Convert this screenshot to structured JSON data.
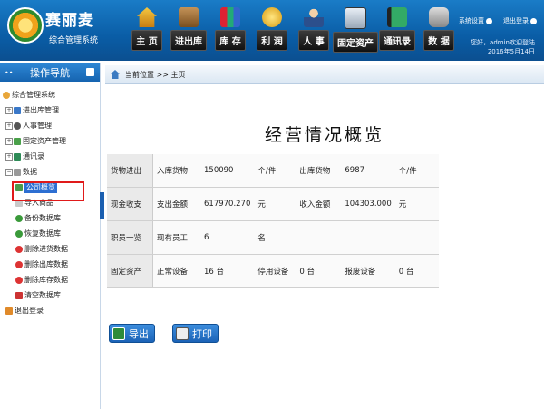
{
  "app": {
    "title": "赛丽麦",
    "subtitle": "综合管理系统"
  },
  "nav": [
    {
      "label": "主 页",
      "icon": "house-icon"
    },
    {
      "label": "进出库",
      "icon": "boxes-icon"
    },
    {
      "label": "库 存",
      "icon": "books-icon"
    },
    {
      "label": "利 润",
      "icon": "coins-icon"
    },
    {
      "label": "人 事",
      "icon": "person-icon"
    },
    {
      "label": "固定资产",
      "icon": "computer-icon"
    },
    {
      "label": "通讯录",
      "icon": "address-book-icon"
    },
    {
      "label": "数 据",
      "icon": "database-icon"
    }
  ],
  "top_links": {
    "settings": "系统设置",
    "logout": "退出登录"
  },
  "user": {
    "greeting": "您好，admin欢迎登陆",
    "date": "2016年5月14日"
  },
  "sidebar": {
    "title": "操作导航",
    "root": "综合管理系统",
    "items": [
      "进出库管理",
      "人事管理",
      "固定资产管理",
      "通讯录"
    ],
    "data_label": "数据",
    "data_children": [
      "公司概览",
      "导入商品",
      "备份数据库",
      "恢复数据库",
      "删除进货数据",
      "删除出库数据",
      "删除库存数据",
      "清空数据库"
    ],
    "logout": "退出登录"
  },
  "breadcrumb": "当前位置 >> 主页",
  "main_title": "经营情况概览",
  "table": [
    [
      "货物进出",
      "入库货物",
      "150090",
      "个/件",
      "出库货物",
      "6987",
      "个/件"
    ],
    [
      "现金收支",
      "支出金额",
      "617970.270",
      "元",
      "收入金额",
      "104303.000",
      "元"
    ],
    [
      "职员一览",
      "现有员工",
      "6",
      "名",
      "",
      "",
      ""
    ],
    [
      "固定资产",
      "正常设备",
      "16 台",
      "停用设备",
      "0 台",
      "报废设备",
      "0 台"
    ]
  ],
  "buttons": {
    "export": "导出",
    "print": "打印"
  }
}
